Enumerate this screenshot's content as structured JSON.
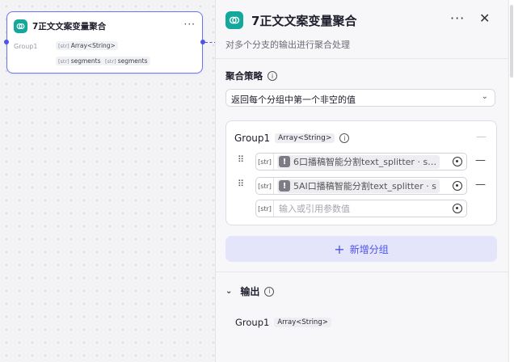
{
  "node": {
    "title": "7正文文案变量聚合",
    "more_label": "···",
    "group_label": "Group1",
    "type_tag": "Array<String>",
    "var_tag_1": "segments",
    "var_tag_2": "segments",
    "bracket_label": "[str]"
  },
  "panel": {
    "title": "7正文文案变量聚合",
    "more_label": "···",
    "close_label": "✕",
    "description": "对多个分支的输出进行聚合处理",
    "strategy_label": "聚合策略",
    "strategy_value": "返回每个分组中第一个非空的值",
    "group": {
      "name": "Group1",
      "type": "Array<String>",
      "items": [
        {
          "type": "[str]",
          "value": "6口播稿智能分割text_splitter · s…"
        },
        {
          "type": "[str]",
          "value": "5AI口播稿智能分割text_splitter · s"
        }
      ],
      "new_item_type": "[str]",
      "new_item_placeholder": "输入或引用参数值"
    },
    "add_group_label": "新增分组",
    "output_label": "输出",
    "output": {
      "name": "Group1",
      "type": "Array<String>"
    }
  },
  "colors": {
    "accent": "#4d53e8",
    "node_icon": "#13a89b"
  }
}
